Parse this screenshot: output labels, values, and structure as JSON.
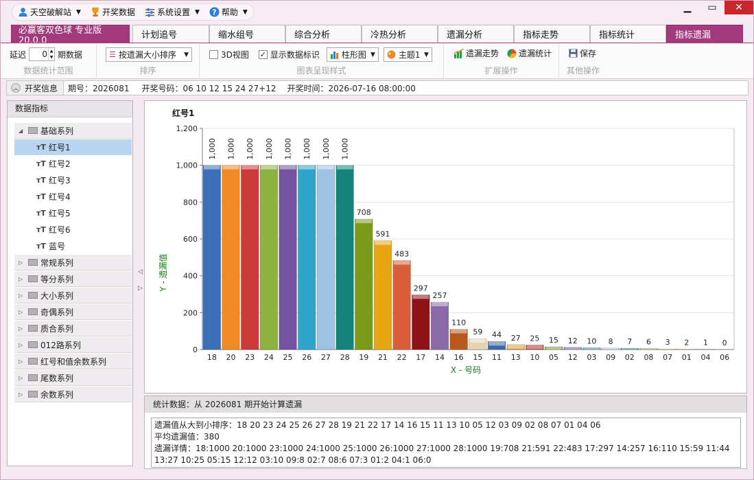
{
  "titlebar": {
    "menus": [
      {
        "label": "天空破解站",
        "icon": "user-icon",
        "caret": true
      },
      {
        "label": "开奖数据",
        "icon": "trophy-icon",
        "caret": false
      },
      {
        "label": "系统设置",
        "icon": "settings-icon",
        "caret": true
      },
      {
        "label": "帮助",
        "icon": "help-icon",
        "caret": true
      }
    ]
  },
  "tabs": {
    "app": "必赢客双色球 专业版 20.0.0",
    "items": [
      "计划追号",
      "缩水组号",
      "综合分析",
      "冷热分析",
      "遗漏分析",
      "指标走势",
      "指标统计",
      "指标遗漏"
    ],
    "active": "指标遗漏"
  },
  "ribbon": {
    "delay_label": "延迟",
    "delay_value": "0",
    "delay_unit": "期数据",
    "group1": "数据统计范围",
    "sort_value": "按遗漏大小排序",
    "group2": "排序",
    "view3d": "3D视图",
    "show_labels": "显示数据标识",
    "chart_type": "柱形图",
    "theme": "主题1",
    "group3": "图表呈现样式",
    "trend": "遗漏走势",
    "stats": "遗漏统计",
    "group4": "扩展操作",
    "save": "保存",
    "group5": "其他操作"
  },
  "info": {
    "lead": "开奖信息",
    "period": "期号：2026081",
    "numbers": "开奖号码：06 10 12 15 24 27+12",
    "time": "开奖时间：2026-07-16 08:00:00"
  },
  "tree": {
    "header": "数据指标",
    "groups": [
      "基础系列",
      "常规系列",
      "等分系列",
      "大小系列",
      "奇偶系列",
      "质合系列",
      "012路系列",
      "红号和值余数系列",
      "尾数系列",
      "余数系列"
    ],
    "leaves": [
      "红号1",
      "红号2",
      "红号3",
      "红号4",
      "红号5",
      "红号6",
      "蓝号"
    ],
    "selected": "红号1"
  },
  "chart_data": {
    "type": "bar",
    "title": "红号1",
    "xlabel": "X - 号码",
    "ylabel": "Y - 遗漏值",
    "ylim": [
      0,
      1200
    ],
    "yticks": [
      "0",
      "200",
      "400",
      "600",
      "800",
      "1,000",
      "1,200"
    ],
    "categories": [
      "18",
      "20",
      "23",
      "24",
      "25",
      "26",
      "27",
      "28",
      "19",
      "21",
      "22",
      "17",
      "14",
      "16",
      "15",
      "11",
      "13",
      "10",
      "05",
      "12",
      "03",
      "09",
      "02",
      "08",
      "07",
      "01",
      "04",
      "06"
    ],
    "values": [
      1000,
      1000,
      1000,
      1000,
      1000,
      1000,
      1000,
      1000,
      708,
      591,
      483,
      297,
      257,
      110,
      59,
      44,
      27,
      25,
      15,
      12,
      10,
      8,
      7,
      6,
      3,
      2,
      1,
      0
    ],
    "labels": [
      "1,000",
      "1,000",
      "1,000",
      "1,000",
      "1,000",
      "1,000",
      "1,000",
      "1,000",
      "708",
      "591",
      "483",
      "297",
      "257",
      "110",
      "59",
      "44",
      "27",
      "25",
      "15",
      "12",
      "10",
      "8",
      "7",
      "6",
      "3",
      "2",
      "1",
      "0"
    ],
    "colors": [
      "#3d6eb8",
      "#ef8a25",
      "#cc3a38",
      "#8cb33e",
      "#7452a0",
      "#2fa6c9",
      "#9ec2e2",
      "#13837c",
      "#7c9a1a",
      "#e7a712",
      "#dc5d3a",
      "#8e1318",
      "#8a6aa6",
      "#b7591a",
      "#e7d4b2",
      "#3f69a8",
      "#d3a43a",
      "#b6332d",
      "#6b9b2c",
      "#6f5390",
      "#2c8fb0",
      "#9ec2e2",
      "#1f7a70",
      "#8ca53a",
      "#d9a235",
      "#c86a3d",
      "#a32323",
      "#8f6fb0"
    ]
  },
  "stats": {
    "header": "统计数据：从 2026081 期开始计算遗漏",
    "line1": "遗漏值从大到小排序：18 20 23 24 25 26 27 28 19 21 22 17 14 16 15 11 13 10 05 12 03 09 02 08 07 01 04 06",
    "line2": "平均遗漏值：380",
    "line3": "遗漏详情：18:1000  20:1000  23:1000  24:1000  25:1000  26:1000  27:1000  28:1000  19:708  21:591  22:483  17:297  14:257  16:110  15:59  11:44",
    "line4": "13:27  10:25  05:15  12:12  03:10  09:8  02:7  08:6  07:3  01:2  04:1  06:0"
  }
}
